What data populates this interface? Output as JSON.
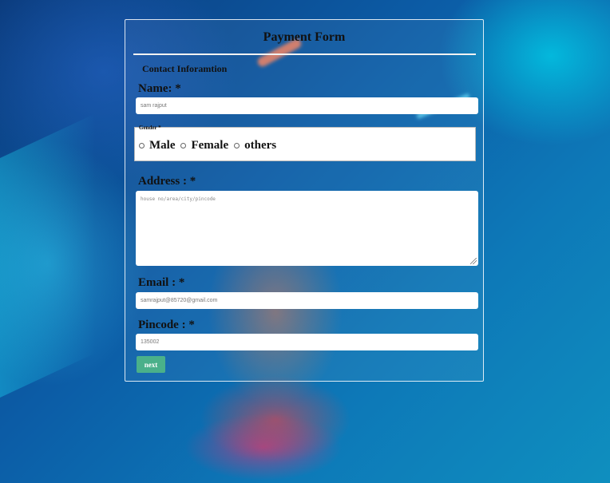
{
  "form": {
    "title": "Payment Form",
    "section_legend": "Contact Inforamtion",
    "name": {
      "label": "Name: *",
      "value": "sam rajput"
    },
    "gender": {
      "legend": "Gender *",
      "options": [
        "Male",
        "Female",
        "others"
      ]
    },
    "address": {
      "label": "Address : *",
      "placeholder": "house no/area/city/pincode"
    },
    "email": {
      "label": "Email : *",
      "value": "samrajput@85720@gmail.com"
    },
    "pincode": {
      "label": "Pincode : *",
      "value": "135002"
    },
    "next_label": "next"
  },
  "colors": {
    "button": "#4ab08a",
    "border": "#ffffff"
  }
}
